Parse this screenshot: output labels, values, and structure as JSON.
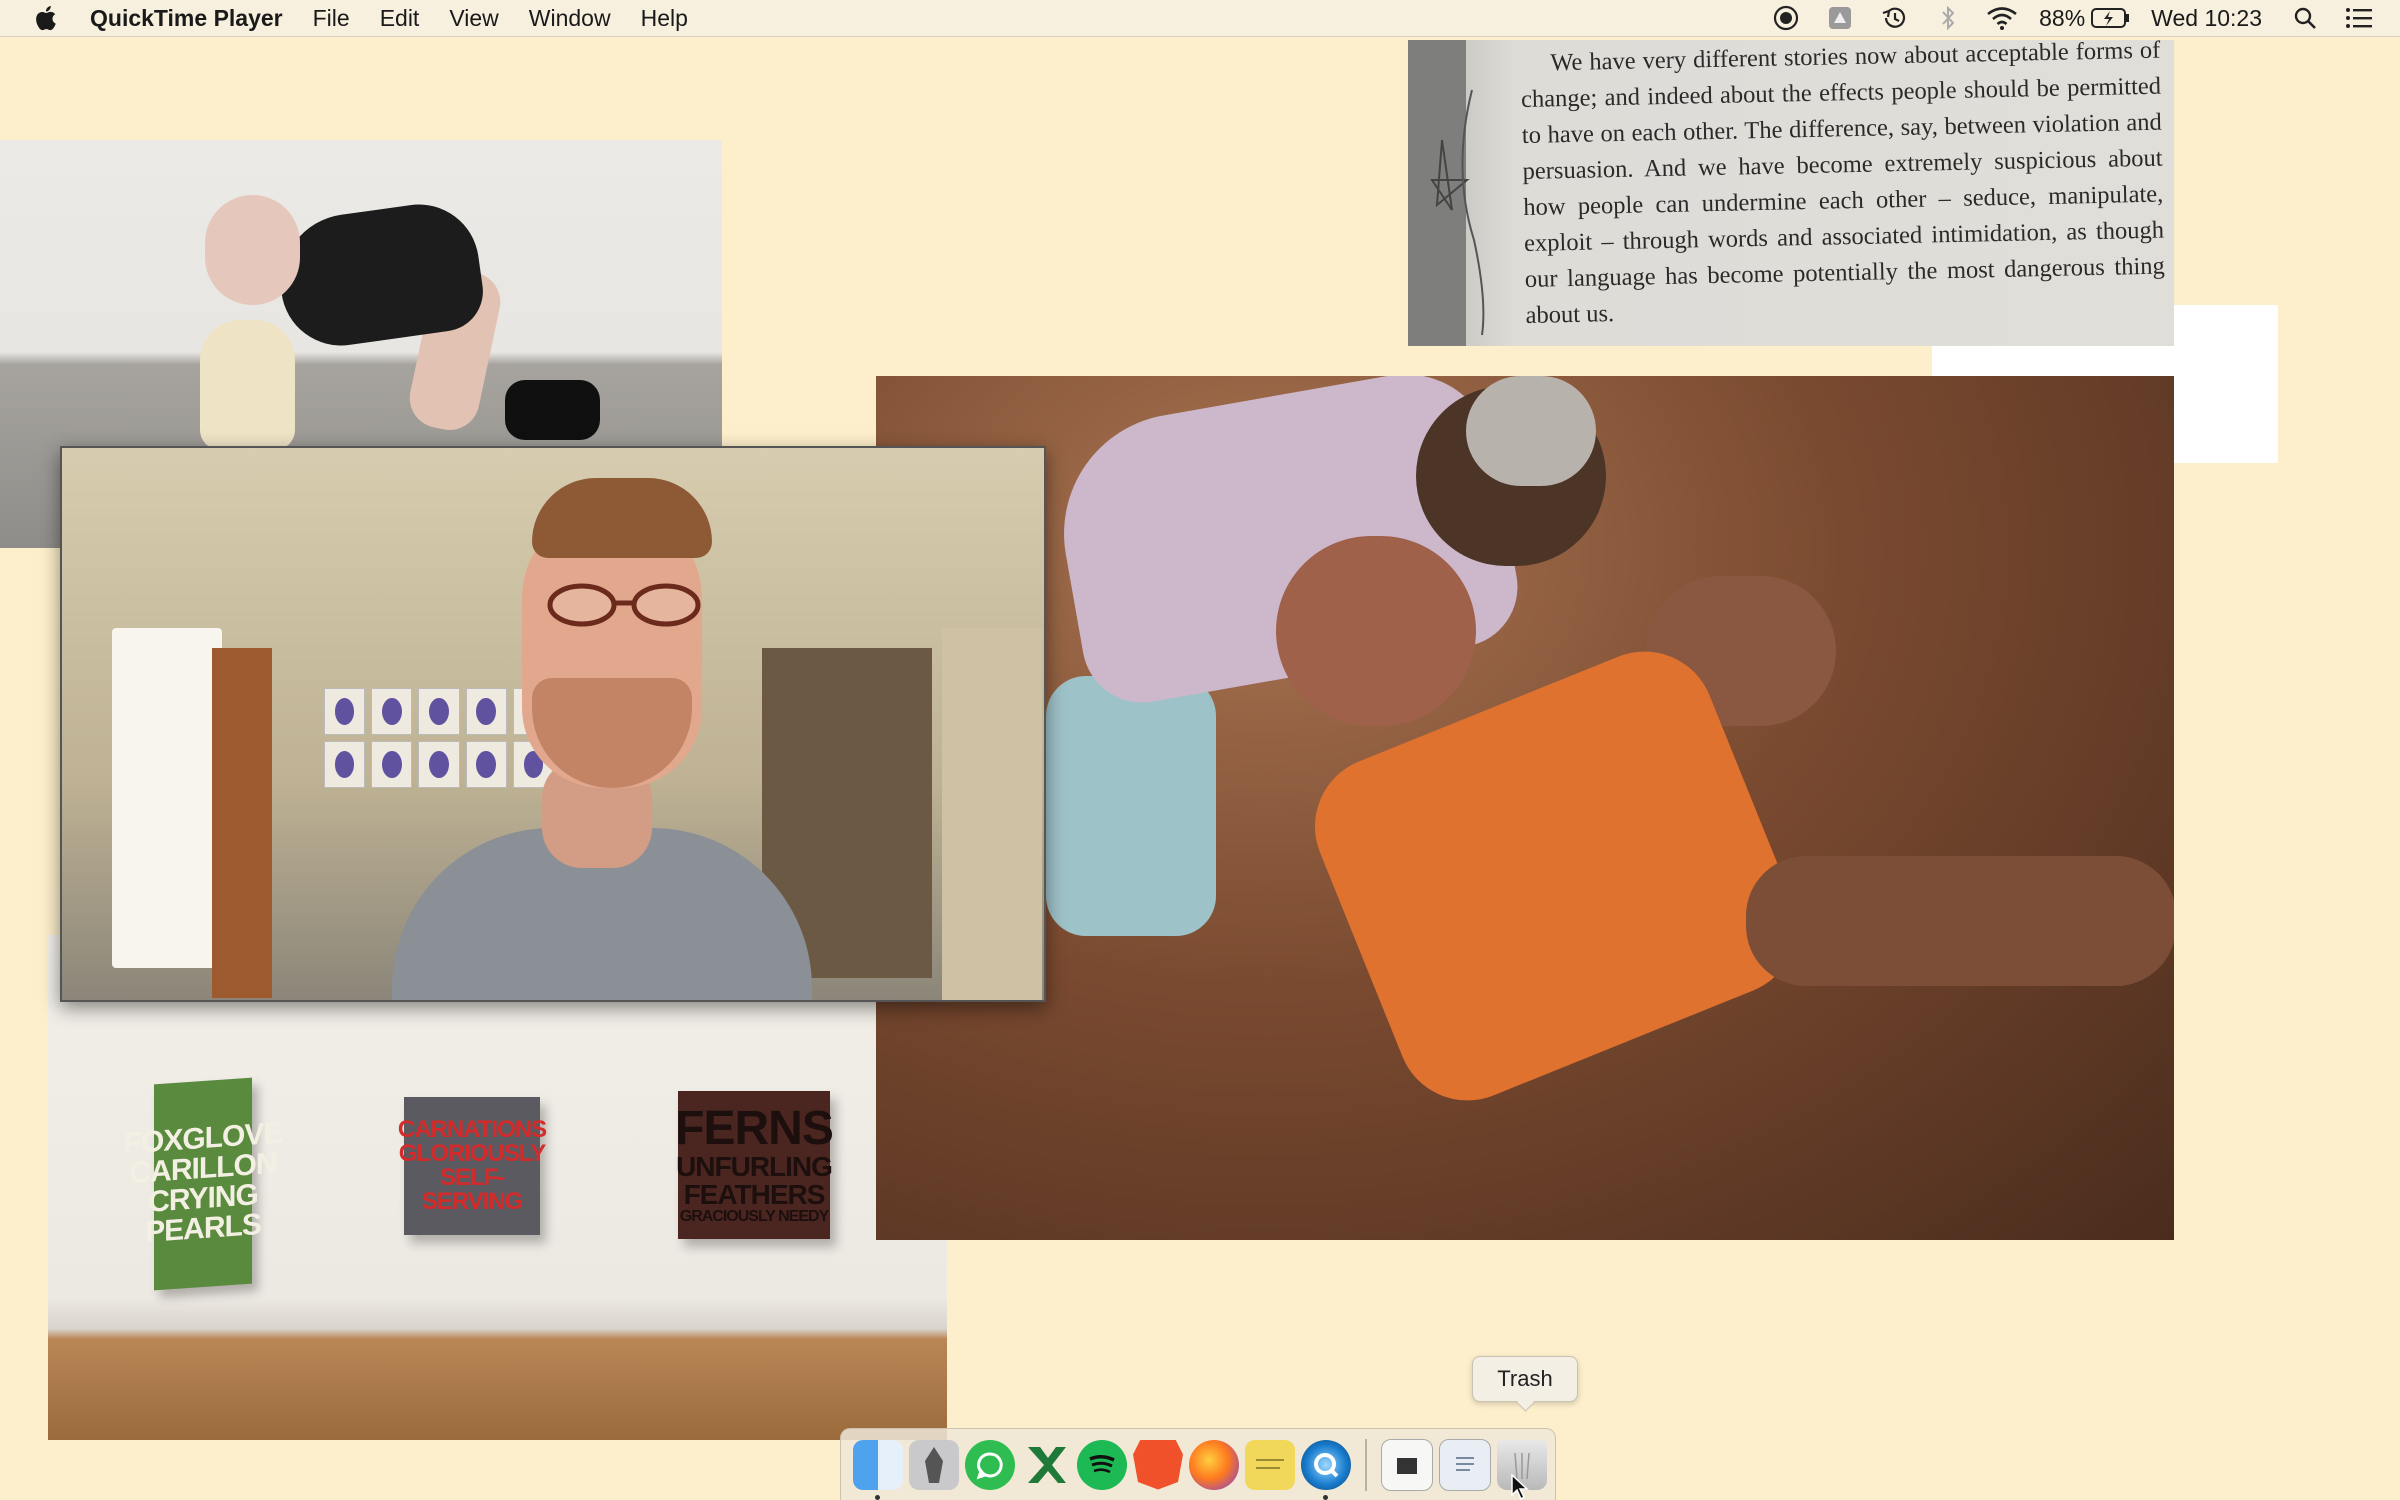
{
  "menubar": {
    "app_name": "QuickTime Player",
    "menus": [
      "File",
      "Edit",
      "View",
      "Window",
      "Help"
    ],
    "battery": "88%",
    "clock": "Wed 10:23",
    "status_icons": [
      "screen-record-icon",
      "drive-icon",
      "time-machine-icon",
      "bluetooth-icon",
      "wifi-icon",
      "battery-charging-icon"
    ],
    "utility_icons": [
      "spotlight-search-icon",
      "notification-center-icon"
    ]
  },
  "book": {
    "text": "We have very different stories now about acceptable forms of change; and indeed about the effects people should be permitted to have on each other. The difference, say, between violation and persuasion. And we have become extremely suspicious about how people can undermine each other – seduce, manipulate, exploit – through words and associated intimidation, as though our language has become potentially the most dangerous thing about us."
  },
  "gallery": {
    "canvas_1": [
      "FOXGLOVE",
      "CARILLON",
      "CRYING",
      "PEARLS"
    ],
    "canvas_2": [
      "CARNATIONS",
      "GLORIOUSLY",
      "SELF-SERVING"
    ],
    "canvas_3": [
      "FERNS",
      "UNFURLING",
      "FEATHERS",
      "GRACIOUSLY NEEDY"
    ]
  },
  "tooltip": {
    "label": "Trash"
  },
  "dock": {
    "items": [
      "finder-icon",
      "launchpad-icon",
      "whatsapp-icon",
      "excel-icon",
      "spotify-icon",
      "brave-icon",
      "firefox-icon",
      "stickies-icon",
      "quicktime-icon",
      "document-icon",
      "document-icon",
      "trash-icon"
    ]
  },
  "colors": {
    "desktop": "#fdefcb",
    "menubar": "#f7f0df",
    "shirt_orange": "#e0722f",
    "canvas_green": "#5a8a3e",
    "canvas_red_text": "#d42a2a"
  }
}
